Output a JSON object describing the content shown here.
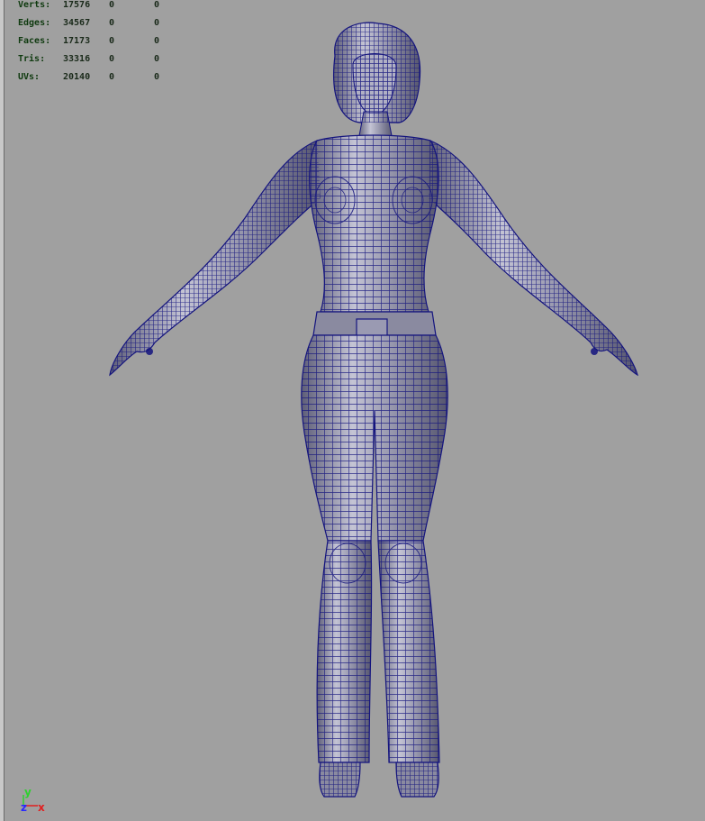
{
  "viewport": {
    "background": "#a0a0a0",
    "wire_color": "#14147e",
    "skin_color": "#8f8fa2"
  },
  "heads_up_display": {
    "rows": [
      {
        "label": "Verts:",
        "total": "17576",
        "selected": "0",
        "highlighted": "0"
      },
      {
        "label": "Edges:",
        "total": "34567",
        "selected": "0",
        "highlighted": "0"
      },
      {
        "label": "Faces:",
        "total": "17173",
        "selected": "0",
        "highlighted": "0"
      },
      {
        "label": "Tris:",
        "total": "33316",
        "selected": "0",
        "highlighted": "0"
      },
      {
        "label": "UVs:",
        "total": "20140",
        "selected": "0",
        "highlighted": "0"
      }
    ]
  },
  "axis_indicator": {
    "y": "y",
    "z": "z",
    "x": "x",
    "y_color": "#2fd12f",
    "z_color": "#2828ff",
    "x_color": "#e02020"
  }
}
